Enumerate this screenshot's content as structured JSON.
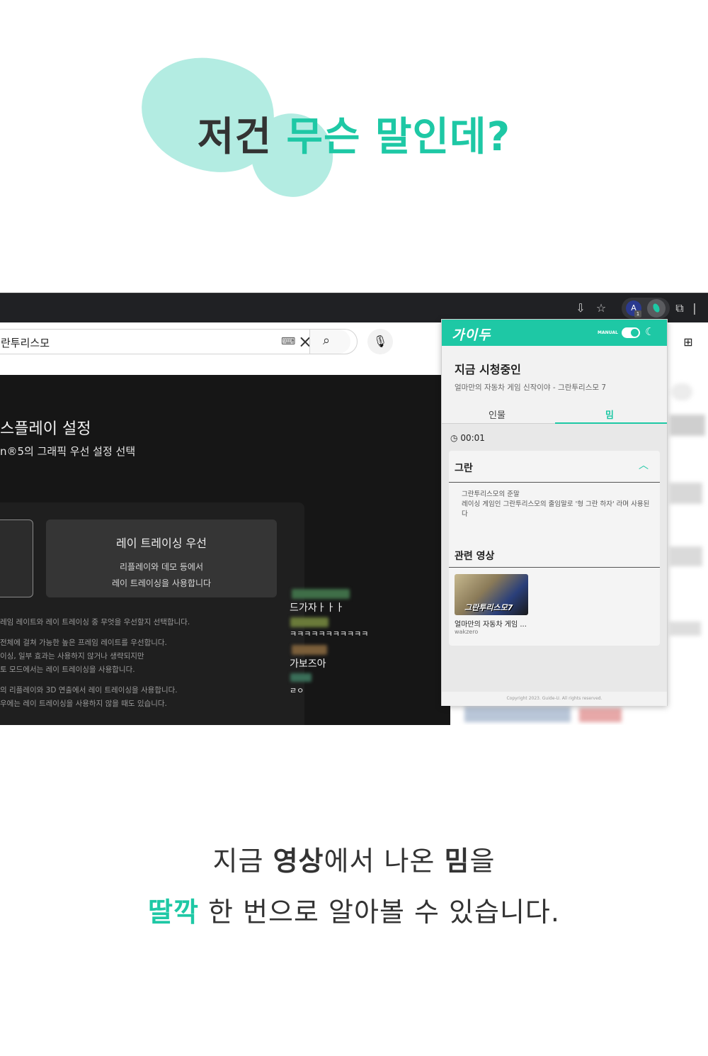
{
  "headline": {
    "part1": "저건",
    "part2": "무슨 말인데?"
  },
  "browser": {
    "search_value": "란투리스모",
    "video": {
      "title": "스플레이 설정",
      "subtitle": "n®5의 그래픽 우선 설정 선택",
      "option_title": "레이 트레이싱 우선",
      "option_desc1": "리플레이와 데모 등에서",
      "option_desc2": "레이 트레이싱을 사용합니다",
      "lines": [
        "레임 레이트와 레이 트레이싱 중 무엇을 우선할지 선택합니다.",
        "전체에 걸쳐 가능한 높은 프레임 레이트를 우선합니다.",
        "이싱, 일부 효과는 사용하지 않거나 생략되지만",
        "토 모드에서는 레이 트레이싱을 사용합니다.",
        "의 리플레이와 3D 연출에서 레이 트레이싱을 사용합니다.",
        "우에는 레이 트레이싱을 사용하지 않을 때도 있습니다."
      ]
    },
    "chat": [
      "드가자ㅏㅏㅏ",
      "ㅋㅋㅋㅋㅋㅋㅋㅋㅋㅋㅋ",
      "가보즈아",
      "ㄹㅇ"
    ]
  },
  "extension": {
    "logo": "가이두",
    "mode_label": "MANUAL",
    "now_watching": "지금 시청중인",
    "video_title": "얼마만의 자동차 게임 신작이야 - 그란투리스모 7",
    "tabs": [
      "인물",
      "밈"
    ],
    "time": "00:01",
    "meme": {
      "title": "그란",
      "desc_line1": "그란투리스모의 준말",
      "desc_line2": "레이싱 게임인 그란투리스모의 줄임말로 '형 그란 하자' 라며 사용된다"
    },
    "related_title": "관련 영상",
    "related": {
      "thumb_text": "그란투리스모7",
      "title": "얼마만의 자동차 게임 ...",
      "channel": "wakzero"
    },
    "footer": "Copyright 2023. Guide-U. All rights reserved."
  },
  "bottom_copy": {
    "line1_a": "지금",
    "line1_b": "영상",
    "line1_c": "에서 나온",
    "line1_d": "밈",
    "line1_e": "을",
    "line2_a": "딸깍",
    "line2_b": "한 번으로 알아볼 수 있습니다."
  },
  "colors": {
    "accent": "#1ec8a5",
    "blob": "#b3ece2",
    "dark_text": "#333333"
  }
}
